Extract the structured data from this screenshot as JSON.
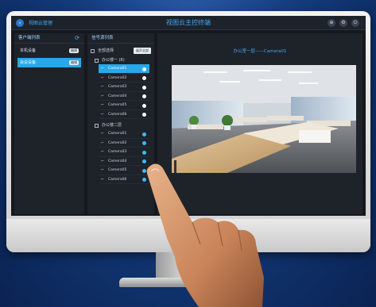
{
  "app": {
    "title": "视图云主控终端",
    "breadcrumb": "视图云管理",
    "buttons": [
      "lock-icon",
      "settings-icon",
      "power-icon"
    ]
  },
  "groups_panel": {
    "title": "客户端列表",
    "items": [
      {
        "label": "本机设备",
        "badge": "编辑",
        "active": false
      },
      {
        "label": "会议设备",
        "badge": "编辑",
        "active": true
      }
    ]
  },
  "signal_panel": {
    "title": "信号源列表",
    "select_all": "全部选择",
    "expand_all": "展开全部",
    "groups": [
      {
        "name": "办公楼一",
        "count": "(6)",
        "cameras": [
          {
            "label": "Camera01",
            "active": true,
            "status": "online"
          },
          {
            "label": "Camera02",
            "active": false,
            "status": "online"
          },
          {
            "label": "Camera03",
            "active": false,
            "status": "online"
          },
          {
            "label": "Camera04",
            "active": false,
            "status": "online"
          },
          {
            "label": "Camera05",
            "active": false,
            "status": "online"
          },
          {
            "label": "Camera06",
            "active": false,
            "status": "online"
          }
        ]
      },
      {
        "name": "办公楼二层",
        "count": "",
        "cameras": [
          {
            "label": "Camera01",
            "active": false,
            "status": "connected"
          },
          {
            "label": "Camera02",
            "active": false,
            "status": "connected"
          },
          {
            "label": "Camera03",
            "active": false,
            "status": "connected"
          },
          {
            "label": "Camera04",
            "active": false,
            "status": "connected"
          },
          {
            "label": "Camera05",
            "active": false,
            "status": "connected"
          },
          {
            "label": "Camera06",
            "active": false,
            "status": "connected"
          }
        ]
      }
    ]
  },
  "preview": {
    "caption": "办公室一层——Camera01"
  },
  "colors": {
    "accent": "#29a8e8",
    "online": "#ffffff",
    "connected": "#3fb9ff"
  }
}
